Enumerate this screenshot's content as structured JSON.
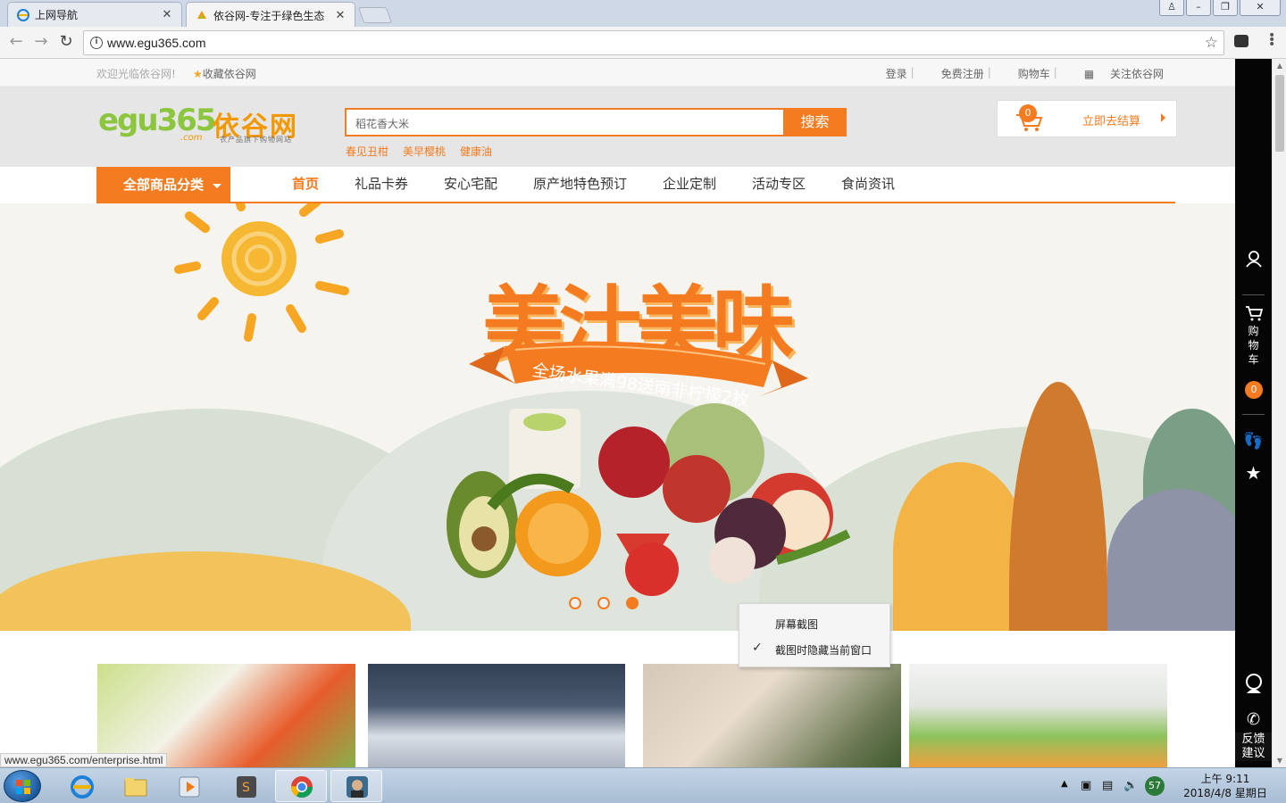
{
  "browser": {
    "tabs": [
      {
        "label": "上网导航",
        "icon": "ie-icon"
      },
      {
        "label": "依谷网-专注于绿色生态",
        "icon": "egu-favicon-icon"
      }
    ],
    "url": "www.egu365.com"
  },
  "topbar": {
    "welcome": "欢迎光临依谷网!",
    "favorite": "收藏依谷网",
    "links": [
      "登录",
      "免费注册",
      "购物车",
      "关注依谷网"
    ]
  },
  "header": {
    "logo_text": "egu365",
    "logo_cn": "依谷网",
    "logo_com": ".com",
    "logo_tagline": "农产品旗下购物网站",
    "search_value": "稻花香大米",
    "search_button": "搜索",
    "hot_words": [
      "春见丑柑",
      "美早樱桃",
      "健康油"
    ],
    "cart_count": "0",
    "checkout": "立即去结算"
  },
  "nav": {
    "all_categories": "全部商品分类",
    "items": [
      "首页",
      "礼品卡券",
      "安心宅配",
      "原产地特色预订",
      "企业定制",
      "活动专区",
      "食尚资讯"
    ]
  },
  "banner": {
    "slogan": "美汁美味",
    "ribbon": "全场水果满98送南非柠檬2枚",
    "active_slide": 3,
    "slide_count": 3
  },
  "context_menu": {
    "items": [
      "屏幕截图",
      "截图时隐藏当前窗口"
    ]
  },
  "status_url": "www.egu365.com/enterprise.html",
  "right_toolbar": {
    "cart_label": "购物车",
    "cart_count": "0",
    "feedback": "反馈建议"
  },
  "taskbar": {
    "tray_badge": "57",
    "time": "上午 9:11",
    "date": "2018/4/8 星期日"
  },
  "colors": {
    "accent": "#f47b20",
    "header_bg": "#e6e6e6",
    "right_bar": "#050505"
  }
}
